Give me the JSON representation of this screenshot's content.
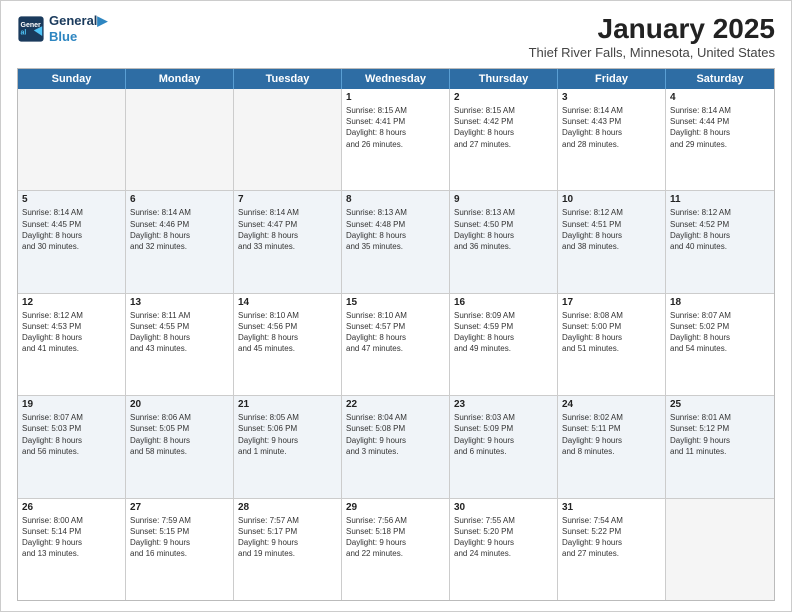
{
  "header": {
    "logo_line1": "General",
    "logo_line2": "Blue",
    "title": "January 2025",
    "subtitle": "Thief River Falls, Minnesota, United States"
  },
  "weekdays": [
    "Sunday",
    "Monday",
    "Tuesday",
    "Wednesday",
    "Thursday",
    "Friday",
    "Saturday"
  ],
  "rows": [
    [
      {
        "day": "",
        "info": "",
        "empty": true
      },
      {
        "day": "",
        "info": "",
        "empty": true
      },
      {
        "day": "",
        "info": "",
        "empty": true
      },
      {
        "day": "1",
        "info": "Sunrise: 8:15 AM\nSunset: 4:41 PM\nDaylight: 8 hours\nand 26 minutes."
      },
      {
        "day": "2",
        "info": "Sunrise: 8:15 AM\nSunset: 4:42 PM\nDaylight: 8 hours\nand 27 minutes."
      },
      {
        "day": "3",
        "info": "Sunrise: 8:14 AM\nSunset: 4:43 PM\nDaylight: 8 hours\nand 28 minutes."
      },
      {
        "day": "4",
        "info": "Sunrise: 8:14 AM\nSunset: 4:44 PM\nDaylight: 8 hours\nand 29 minutes."
      }
    ],
    [
      {
        "day": "5",
        "info": "Sunrise: 8:14 AM\nSunset: 4:45 PM\nDaylight: 8 hours\nand 30 minutes."
      },
      {
        "day": "6",
        "info": "Sunrise: 8:14 AM\nSunset: 4:46 PM\nDaylight: 8 hours\nand 32 minutes."
      },
      {
        "day": "7",
        "info": "Sunrise: 8:14 AM\nSunset: 4:47 PM\nDaylight: 8 hours\nand 33 minutes."
      },
      {
        "day": "8",
        "info": "Sunrise: 8:13 AM\nSunset: 4:48 PM\nDaylight: 8 hours\nand 35 minutes."
      },
      {
        "day": "9",
        "info": "Sunrise: 8:13 AM\nSunset: 4:50 PM\nDaylight: 8 hours\nand 36 minutes."
      },
      {
        "day": "10",
        "info": "Sunrise: 8:12 AM\nSunset: 4:51 PM\nDaylight: 8 hours\nand 38 minutes."
      },
      {
        "day": "11",
        "info": "Sunrise: 8:12 AM\nSunset: 4:52 PM\nDaylight: 8 hours\nand 40 minutes."
      }
    ],
    [
      {
        "day": "12",
        "info": "Sunrise: 8:12 AM\nSunset: 4:53 PM\nDaylight: 8 hours\nand 41 minutes."
      },
      {
        "day": "13",
        "info": "Sunrise: 8:11 AM\nSunset: 4:55 PM\nDaylight: 8 hours\nand 43 minutes."
      },
      {
        "day": "14",
        "info": "Sunrise: 8:10 AM\nSunset: 4:56 PM\nDaylight: 8 hours\nand 45 minutes."
      },
      {
        "day": "15",
        "info": "Sunrise: 8:10 AM\nSunset: 4:57 PM\nDaylight: 8 hours\nand 47 minutes."
      },
      {
        "day": "16",
        "info": "Sunrise: 8:09 AM\nSunset: 4:59 PM\nDaylight: 8 hours\nand 49 minutes."
      },
      {
        "day": "17",
        "info": "Sunrise: 8:08 AM\nSunset: 5:00 PM\nDaylight: 8 hours\nand 51 minutes."
      },
      {
        "day": "18",
        "info": "Sunrise: 8:07 AM\nSunset: 5:02 PM\nDaylight: 8 hours\nand 54 minutes."
      }
    ],
    [
      {
        "day": "19",
        "info": "Sunrise: 8:07 AM\nSunset: 5:03 PM\nDaylight: 8 hours\nand 56 minutes."
      },
      {
        "day": "20",
        "info": "Sunrise: 8:06 AM\nSunset: 5:05 PM\nDaylight: 8 hours\nand 58 minutes."
      },
      {
        "day": "21",
        "info": "Sunrise: 8:05 AM\nSunset: 5:06 PM\nDaylight: 9 hours\nand 1 minute."
      },
      {
        "day": "22",
        "info": "Sunrise: 8:04 AM\nSunset: 5:08 PM\nDaylight: 9 hours\nand 3 minutes."
      },
      {
        "day": "23",
        "info": "Sunrise: 8:03 AM\nSunset: 5:09 PM\nDaylight: 9 hours\nand 6 minutes."
      },
      {
        "day": "24",
        "info": "Sunrise: 8:02 AM\nSunset: 5:11 PM\nDaylight: 9 hours\nand 8 minutes."
      },
      {
        "day": "25",
        "info": "Sunrise: 8:01 AM\nSunset: 5:12 PM\nDaylight: 9 hours\nand 11 minutes."
      }
    ],
    [
      {
        "day": "26",
        "info": "Sunrise: 8:00 AM\nSunset: 5:14 PM\nDaylight: 9 hours\nand 13 minutes."
      },
      {
        "day": "27",
        "info": "Sunrise: 7:59 AM\nSunset: 5:15 PM\nDaylight: 9 hours\nand 16 minutes."
      },
      {
        "day": "28",
        "info": "Sunrise: 7:57 AM\nSunset: 5:17 PM\nDaylight: 9 hours\nand 19 minutes."
      },
      {
        "day": "29",
        "info": "Sunrise: 7:56 AM\nSunset: 5:18 PM\nDaylight: 9 hours\nand 22 minutes."
      },
      {
        "day": "30",
        "info": "Sunrise: 7:55 AM\nSunset: 5:20 PM\nDaylight: 9 hours\nand 24 minutes."
      },
      {
        "day": "31",
        "info": "Sunrise: 7:54 AM\nSunset: 5:22 PM\nDaylight: 9 hours\nand 27 minutes."
      },
      {
        "day": "",
        "info": "",
        "empty": true
      }
    ]
  ]
}
